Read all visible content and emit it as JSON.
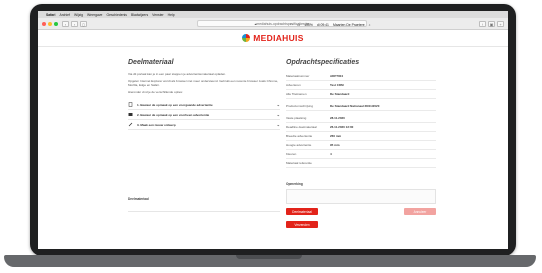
{
  "colors": {
    "brand": "#e2231a",
    "button_disabled": "#f2a3a0"
  },
  "menubar": {
    "app": "Safari",
    "items": [
      "Archief",
      "Wijzig",
      "Weergave",
      "Geschiedenis",
      "Bladwijzers",
      "Venster",
      "Help"
    ],
    "status": [
      "100%",
      "di 09:41",
      "Maarten De Praetere"
    ]
  },
  "browser": {
    "url": "mediahuis-opdrachtspecificaties.be",
    "icons": [
      "back-icon",
      "forward-icon",
      "sidebar-icon",
      "share-icon",
      "tabs-icon",
      "add-tab-icon"
    ]
  },
  "brand": {
    "name": "MEDIAHUIS"
  },
  "left": {
    "title": "Deelmateriaal",
    "intro": "Via dit portaal kan je in een paar stappen je advertentiemateriaal opladen.",
    "browser_note": "Opgelet: Internet Explorer wordt als browser niet meer ondersteund. Gebruik een recente browser zoals Chrome, Mozilla, Edge en Safari.",
    "steps_intro": "Hieronder vind je de verschillende opties:",
    "steps": [
      {
        "label": "1. Bewaar de opmaak op een voorgaande advertentie",
        "icon": "document-icon"
      },
      {
        "label": "2. Bewaar de opmaak op een voorheen advertentie",
        "icon": "image-icon"
      },
      {
        "label": "3. Maak een nieuw ontwerp",
        "icon": "pencil-icon"
      }
    ],
    "upload_label": "Deelmateriaal"
  },
  "right": {
    "title": "Opdrachtspecificaties",
    "specs": [
      {
        "key": "Materiaalnummer",
        "value": "ADP7004"
      },
      {
        "key": "Adverteren",
        "value": "Test CDM"
      },
      {
        "key": "Alle Titelnamen",
        "value": "De Standaard"
      },
      {
        "key": "Productomschrijving",
        "value": "De Standaard Nationaal 28/11/2020"
      },
      {
        "key": "Vaste plaatsing",
        "value": "28.11.2020"
      },
      {
        "key": "Deadline deelmateriaal",
        "value": "26.11.2020 12:00"
      },
      {
        "key": "Breedte advertentie",
        "value": "260 mm"
      },
      {
        "key": "Hoogte advertentie",
        "value": "95 mm"
      },
      {
        "key": "Kleuren",
        "value": "4"
      },
      {
        "key": "Materiaal referentie",
        "value": ""
      }
    ],
    "remark_label": "Opmerking",
    "remark_value": "",
    "buttons": {
      "primary": "Deelmateriaal",
      "secondary": "Annuleer",
      "send": "Verzenden"
    }
  }
}
